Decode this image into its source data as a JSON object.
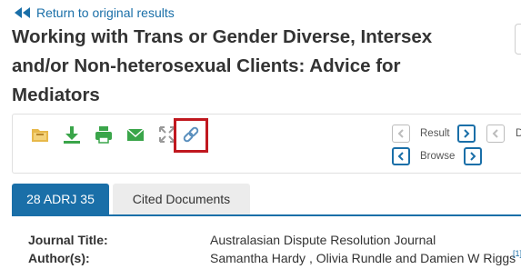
{
  "nav": {
    "back_label": "Return to original results"
  },
  "document": {
    "title": "Working with Trans or Gender Diverse, Intersex and/or Non-heterosexual Clients: Advice for Mediators"
  },
  "toolbar": {
    "tools": [
      "folder-icon",
      "download-icon",
      "print-icon",
      "email-icon",
      "fullscreen-icon",
      "permalink-icon"
    ]
  },
  "navigation": {
    "result_label": "Result",
    "browse_label": "Browse",
    "cut_label": "D"
  },
  "tabs": [
    {
      "label": "28 ADRJ 35"
    },
    {
      "label": "Cited Documents"
    }
  ],
  "metadata": [
    {
      "label": "Journal Title:",
      "value": "Australasian Dispute Resolution Journal"
    },
    {
      "label": "Author(s):",
      "value": "Samantha Hardy , Olivia Rundle and Damien W Riggs"
    }
  ],
  "footnote_mark": "[1]",
  "colors": {
    "accent": "#1a6fa8",
    "highlight": "#c0181f",
    "icon_green": "#3aa54a",
    "folder_yellow": "#e7b84a"
  }
}
